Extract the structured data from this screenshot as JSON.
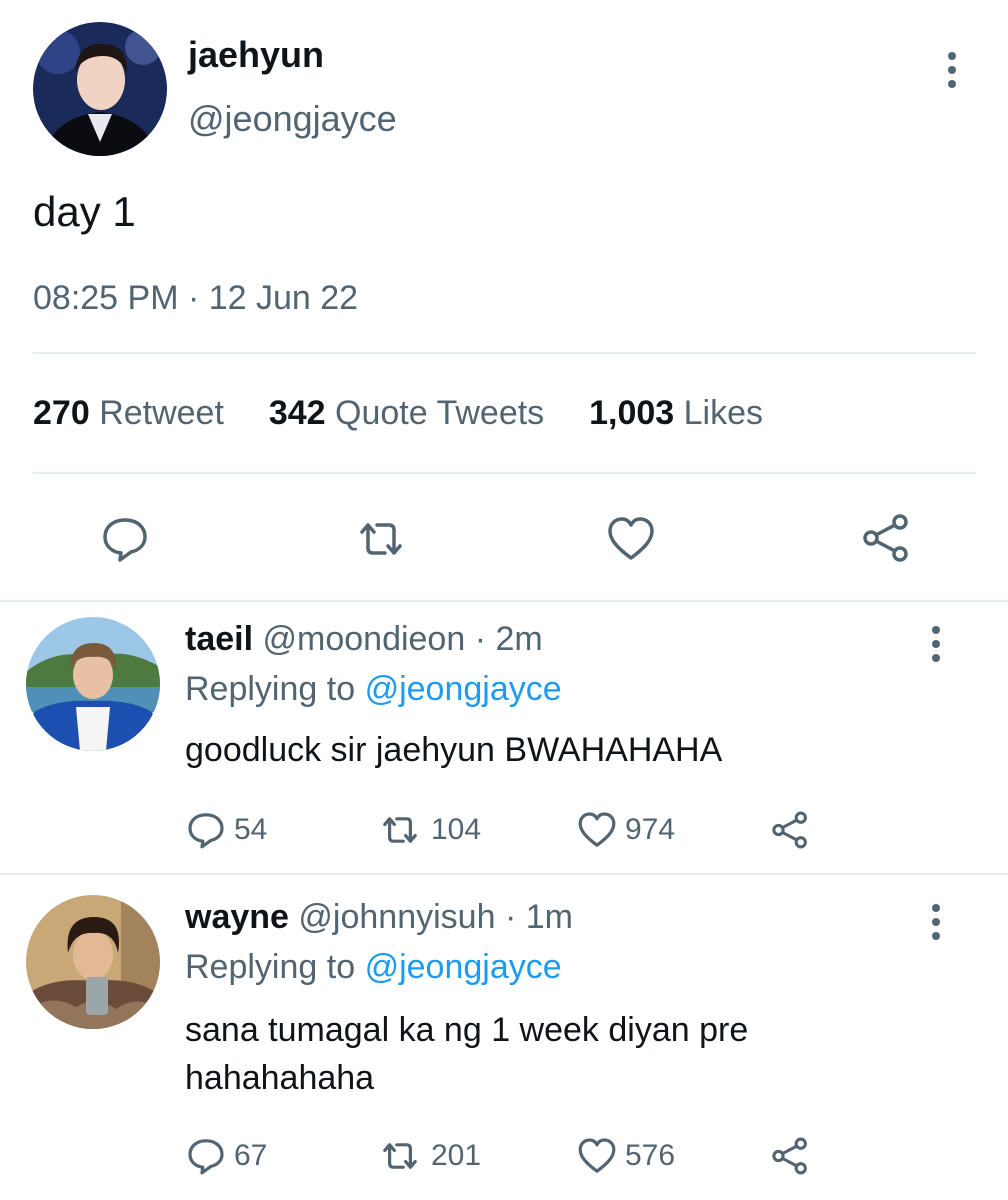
{
  "tweet": {
    "author_name": "jaehyun",
    "author_handle": "@jeongjayce",
    "text": "day 1",
    "timestamp": "08:25 PM · 12 Jun 22",
    "stats": {
      "retweets_count": "270",
      "retweets_label": "Retweet",
      "quotes_count": "342",
      "quotes_label": "Quote Tweets",
      "likes_count": "1,003",
      "likes_label": "Likes"
    },
    "icons": [
      "reply-icon",
      "retweet-icon",
      "like-icon",
      "share-icon"
    ]
  },
  "replies": [
    {
      "name": "taeil",
      "handle": "@moondieon",
      "time": "2m",
      "replying_label": "Replying to",
      "replying_to": "@jeongjayce",
      "text": "goodluck sir jaehyun BWAHAHAHA",
      "reply_count": "54",
      "retweet_count": "104",
      "like_count": "974"
    },
    {
      "name": "wayne",
      "handle": "@johnnyisuh",
      "time": "1m",
      "replying_label": "Replying to",
      "replying_to": "@jeongjayce",
      "text_line1": "sana tumagal ka ng 1 week diyan pre",
      "text_line2": "hahahahaha",
      "reply_count": "67",
      "retweet_count": "201",
      "like_count": "576"
    }
  ],
  "colors": {
    "accent": "#1d9bf0",
    "secondary_text": "#536471",
    "divider": "#e6ecf0"
  }
}
